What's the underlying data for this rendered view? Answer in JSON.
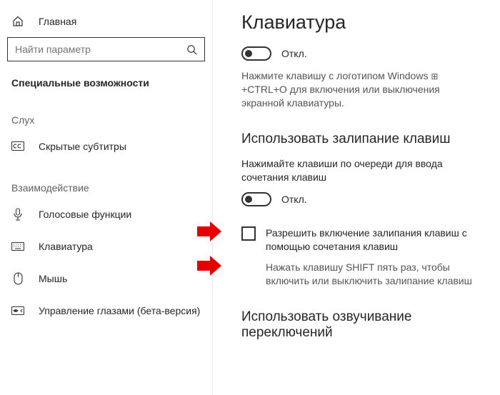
{
  "sidebar": {
    "home": "Главная",
    "search_placeholder": "Найти параметр",
    "category": "Специальные возможности",
    "group1": "Слух",
    "item_cc": "Скрытые субтитры",
    "group2": "Взаимодействие",
    "item_speech": "Голосовые функции",
    "item_keyboard": "Клавиатура",
    "item_mouse": "Мышь",
    "item_eyecontrol": "Управление глазами (бета-версия)"
  },
  "main": {
    "title": "Клавиатура",
    "osk_toggle": "Откл.",
    "osk_desc_a": "Нажмите клавишу с логотипом Windows ",
    "osk_desc_b": " +CTRL+O для включения или выключения экранной клавиатуры.",
    "sticky_title": "Использовать залипание клавиш",
    "sticky_sub": "Нажимайте клавиши по очереди для ввода сочетания клавиш",
    "sticky_toggle": "Откл.",
    "sticky_check": "Разрешить включение залипания клавиш с помощью сочетания клавиш",
    "sticky_hint": "Нажать клавишу SHIFT пять раз, чтобы включить или выключить залипание клавиш",
    "togglekeys_title": "Использовать озвучивание переключений"
  }
}
